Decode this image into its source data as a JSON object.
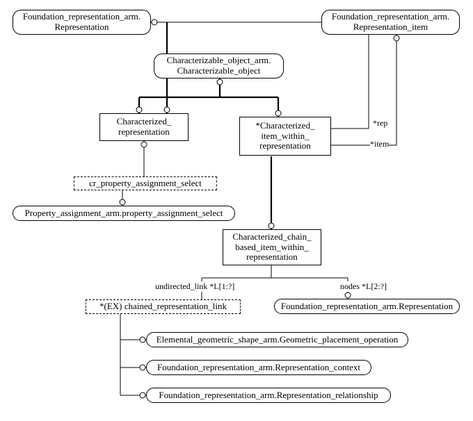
{
  "entities": {
    "representation": {
      "l1": "Foundation_representation_arm.",
      "l2": "Representation"
    },
    "representation_item": {
      "l1": "Foundation_representation_arm.",
      "l2": "Representation_item"
    },
    "characterizable_object": {
      "l1": "Characterizable_object_arm.",
      "l2": "Characterizable_object"
    },
    "characterized_representation": {
      "l1": "Characterized_",
      "l2": "representation"
    },
    "characterized_item_within_representation": {
      "l1": "*Characterized_",
      "l2": "item_within_",
      "l3": "representation"
    },
    "characterized_chain_based_item_within_representation": {
      "l1": "Characterized_chain_",
      "l2": "based_item_within_",
      "l3": "representation"
    },
    "cr_property_assignment_select": "cr_property_assignment_select",
    "property_assignment_select": "Property_assignment_arm.property_assignment_select",
    "chained_representation_link": "*(EX) chained_representation_link",
    "geometric_placement_operation": "Elemental_geometric_shape_arm.Geometric_placement_operation",
    "representation_context": "Foundation_representation_arm.Representation_context",
    "representation_relationship": "Foundation_representation_arm.Representation_relationship",
    "representation_ref": "Foundation_representation_arm.Representation"
  },
  "attributes": {
    "rep": "*rep",
    "item": "*item",
    "undirected_link": "undirected_link *L[1:?]",
    "nodes": "nodes *L[2:?]"
  }
}
